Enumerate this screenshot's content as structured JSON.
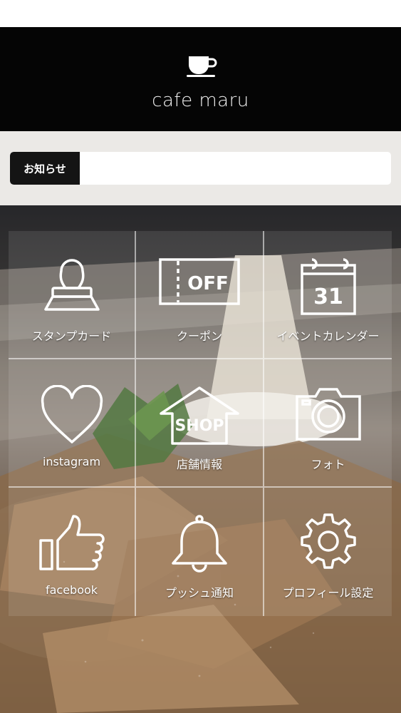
{
  "header": {
    "logo_text": "cafe maru",
    "logo_icon": "coffee-cup-icon"
  },
  "news": {
    "label": "お知らせ",
    "text": ""
  },
  "menu": {
    "items": [
      {
        "label": "スタンプカード",
        "icon": "stamp-icon"
      },
      {
        "label": "クーポン",
        "icon": "coupon-icon",
        "icon_text": "OFF"
      },
      {
        "label": "イベントカレンダー",
        "icon": "calendar-icon",
        "icon_text": "31"
      },
      {
        "label": "instagram",
        "icon": "heart-icon"
      },
      {
        "label": "店舗情報",
        "icon": "shop-icon",
        "icon_text": "SHOP"
      },
      {
        "label": "フォト",
        "icon": "camera-icon"
      },
      {
        "label": "facebook",
        "icon": "thumbs-up-icon"
      },
      {
        "label": "プッシュ通知",
        "icon": "bell-icon"
      },
      {
        "label": "プロフィール設定",
        "icon": "gear-icon"
      }
    ]
  },
  "colors": {
    "header_bg": "#050505",
    "news_strip_bg": "#ebe9e6",
    "news_label_bg": "#141414",
    "icon_stroke": "#ffffff"
  }
}
